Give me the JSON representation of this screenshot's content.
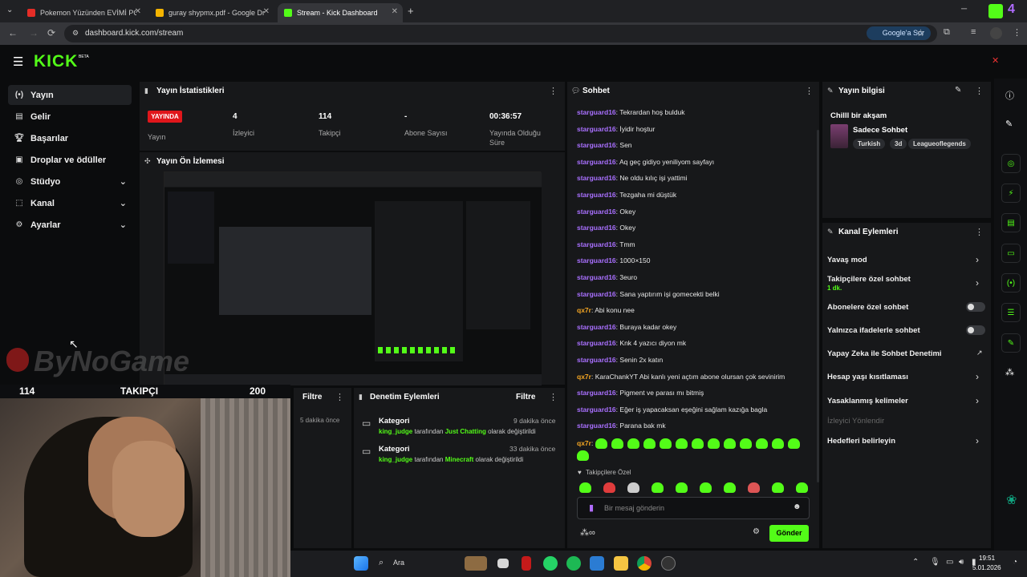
{
  "browser": {
    "tabs": [
      {
        "label": "Pokemon Yüzünden EVİMİ POLİ",
        "active": false
      },
      {
        "label": "guray shypmx.pdf - Google Drive",
        "active": false
      },
      {
        "label": "Stream - Kick Dashboard",
        "active": true
      }
    ],
    "url": "dashboard.kick.com/stream",
    "google_ask": "Google'a Sor",
    "colors": {
      "accent": "#53fc18",
      "username": "#a970ff",
      "mod_user": "#f5a623"
    }
  },
  "app": {
    "logo": "KICK",
    "beta": "BETA"
  },
  "nav": {
    "items": [
      {
        "label": "Yayın",
        "icon": "broadcast-icon",
        "chevron": false
      },
      {
        "label": "Gelir",
        "icon": "revenue-icon",
        "chevron": false
      },
      {
        "label": "Başarılar",
        "icon": "trophy-icon",
        "chevron": false
      },
      {
        "label": "Droplar ve ödüller",
        "icon": "gift-icon",
        "chevron": false
      },
      {
        "label": "Stüdyo",
        "icon": "studio-icon",
        "chevron": true
      },
      {
        "label": "Kanal",
        "icon": "channel-icon",
        "chevron": true
      },
      {
        "label": "Ayarlar",
        "icon": "settings-icon",
        "chevron": true
      }
    ]
  },
  "stats": {
    "title": "Yayın İstatistikleri",
    "live_badge": "YAYINDA",
    "live_label": "Yayın",
    "viewers": {
      "value": "4",
      "label": "İzleyici"
    },
    "followers": {
      "value": "114",
      "label": "Takipçi"
    },
    "subscribers": {
      "value": "-",
      "label": "Abone Sayısı"
    },
    "uptime": {
      "value": "00:36:57",
      "label": "Yayında Olduğu Süre"
    }
  },
  "preview": {
    "title": "Yayın Ön İzlemesi"
  },
  "overlay": {
    "left_count": "114",
    "center_label": "TAKIPÇI",
    "right_count": "200",
    "watermark": "ByNoGame"
  },
  "filter_panel": {
    "label": "Filtre",
    "time": "5 dakika önce"
  },
  "moderation": {
    "title": "Denetim Eylemleri",
    "filter": "Filtre",
    "entries": [
      {
        "type": "Kategori",
        "time": "9 dakika önce",
        "user": "king_judge",
        "by": "tarafından",
        "target": "Just Chatting",
        "suffix": "olarak değiştirildi"
      },
      {
        "type": "Kategori",
        "time": "33 dakika önce",
        "user": "king_judge",
        "by": "tarafından",
        "target": "Minecraft",
        "suffix": "olarak değiştirildi"
      }
    ]
  },
  "chat": {
    "title": "Sohbet",
    "messages": [
      {
        "user": "starguard16",
        "text": "Tekrardan hoş bulduk",
        "mod": false
      },
      {
        "user": "starguard16",
        "text": "İyidir hoştur",
        "mod": false
      },
      {
        "user": "starguard16",
        "text": "Sen",
        "mod": false
      },
      {
        "user": "starguard16",
        "text": "Aq geç gidiyo yeniliyom sayfayı",
        "mod": false
      },
      {
        "user": "starguard16",
        "text": "Ne oldu kılıç işi yattimi",
        "mod": false
      },
      {
        "user": "starguard16",
        "text": "Tezgaha mi düştük",
        "mod": false
      },
      {
        "user": "starguard16",
        "text": "Okey",
        "mod": false
      },
      {
        "user": "starguard16",
        "text": "Okey",
        "mod": false
      },
      {
        "user": "starguard16",
        "text": "Tmm",
        "mod": false
      },
      {
        "user": "starguard16",
        "text": "1000×150",
        "mod": false
      },
      {
        "user": "starguard16",
        "text": "3euro",
        "mod": false
      },
      {
        "user": "starguard16",
        "text": "Sana yaptırım işi gomecekti belki",
        "mod": false
      },
      {
        "user": "qx7r",
        "text": "Abi konu nee",
        "mod": true
      },
      {
        "user": "starguard16",
        "text": "Buraya kadar okey",
        "mod": false
      },
      {
        "user": "starguard16",
        "text": "Knk 4 yazıcı diyon mk",
        "mod": false
      },
      {
        "user": "starguard16",
        "text": "Senin 2x katın",
        "mod": false
      },
      {
        "user": "qx7r",
        "text": "KaraChankYT Abi kanlı yeni açtım abone olursan çok sevinirim",
        "mod": true
      },
      {
        "user": "starguard16",
        "text": "Pigment ve parası mı bitmiş",
        "mod": false
      },
      {
        "user": "starguard16",
        "text": "Eğer iş yapacaksan eşeğini sağlam kazığa bagla",
        "mod": false
      },
      {
        "user": "starguard16",
        "text": "Parana bak mk",
        "mod": false
      }
    ],
    "emote_user": "qx7r",
    "followers_only": "Takipçilere Özel",
    "input_placeholder": "Bir mesaj gönderin",
    "send": "Gönder"
  },
  "stream_info": {
    "title": "Yayın bilgisi",
    "stream_title": "Chilll bir akşam",
    "category": "Sadece Sohbet",
    "tags": [
      "Turkish",
      "3d",
      "Leagueoflegends"
    ]
  },
  "channel_actions": {
    "title": "Kanal Eylemleri",
    "items": [
      {
        "label": "Yavaş mod",
        "sub": "",
        "control": "chevron"
      },
      {
        "label": "Takipçilere özel sohbet",
        "sub": "1 dk.",
        "control": "chevron"
      },
      {
        "label": "Abonelere özel sohbet",
        "sub": "",
        "control": "toggle"
      },
      {
        "label": "Yalnızca ifadelerle sohbet",
        "sub": "",
        "control": "toggle"
      },
      {
        "label": "Yapay Zeka ile Sohbet Denetimi",
        "sub": "",
        "control": "external"
      },
      {
        "label": "Hesap yaşı kısıtlaması",
        "sub": "",
        "control": "chevron"
      },
      {
        "label": "Yasaklanmış kelimeler",
        "sub": "",
        "control": "chevron"
      },
      {
        "label": "İzleyici Yönlendir",
        "sub": "",
        "control": "disabled"
      },
      {
        "label": "Hedefleri belirleyin",
        "sub": "",
        "control": "chevron"
      }
    ]
  },
  "taskbar": {
    "search": "Ara",
    "time": "19:51",
    "date": "5.01.2026"
  }
}
